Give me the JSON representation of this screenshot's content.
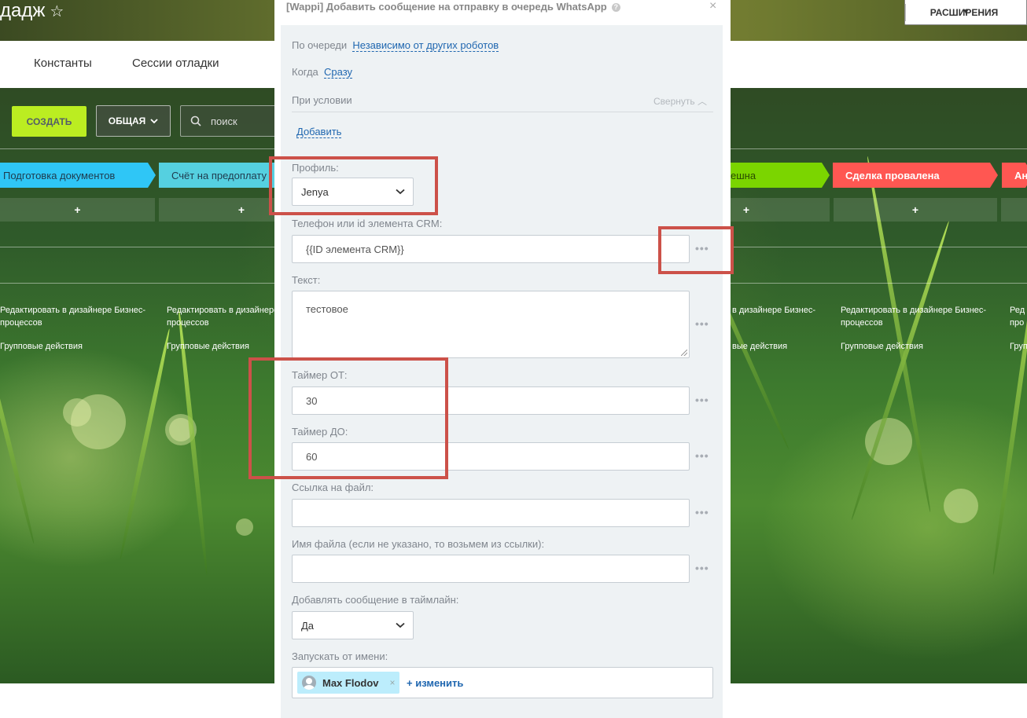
{
  "header": {
    "page_title": "дадж",
    "star_icon": "☆",
    "extensions_label": "РАСШИРЕНИЯ"
  },
  "nav": {
    "constants": "Константы",
    "debug_sessions": "Сессии отладки"
  },
  "toolbar": {
    "create_label": "СОЗДАТЬ",
    "filter_label": "ОБЩАЯ",
    "search_placeholder": "поиск"
  },
  "stages": [
    {
      "label": "Подготовка документов",
      "color": "#2fc6f6"
    },
    {
      "label": "Счёт на предоплату",
      "color": "#55d0e0"
    },
    {
      "label": "ешна",
      "color": "#7bd500"
    },
    {
      "label": "Сделка провалена",
      "color": "#ff5752"
    },
    {
      "label": "Ан",
      "color": "#ff5752"
    }
  ],
  "stage_add": "+",
  "column_links": {
    "edit_designer": "Редактировать в дизайнере Бизнес-процессов",
    "edit_designer_line1": "Редактировать в дизайнере Бизнес-",
    "edit_designer_line2": "процессов",
    "edit_designer_cut1": "в дизайнере Бизнес-",
    "edit_designer_cut2": "Ред",
    "edit_designer_cut3": "про",
    "edit_designer_cut4": "Редактировать в дизайнере",
    "edit_designer_cut5": "процессов",
    "group_actions": "Групповые действия",
    "group_actions_cut1": "вые действия",
    "group_actions_cut2": "Груп"
  },
  "dialog": {
    "title": "[Wappi] Добавить сообщение на отправку в очередь WhatsApp",
    "queue_label": "По очереди",
    "queue_value": "Независимо от других роботов",
    "when_label": "Когда",
    "when_value": "Сразу",
    "condition_label": "При условии",
    "collapse_label": "Свернуть",
    "add_label": "Добавить",
    "profile_label": "Профиль:",
    "profile_value": "Jenya",
    "phone_label": "Телефон или id элемента CRM:",
    "phone_value": "{{ID элемента CRM}}",
    "text_label": "Текст:",
    "text_value": "тестовое",
    "timer_from_label": "Таймер ОТ:",
    "timer_from_value": "30",
    "timer_to_label": "Таймер ДО:",
    "timer_to_value": "60",
    "file_link_label": "Ссылка на файл:",
    "file_link_value": "",
    "file_name_label": "Имя файла (если не указано, то возьмем из ссылки):",
    "file_name_value": "",
    "timeline_label": "Добавлять сообщение в таймлайн:",
    "timeline_value": "Да",
    "run_as_label": "Запускать от имени:",
    "run_as_user": "Max Flodov",
    "change_label": "+ изменить",
    "more_dots": "•••"
  },
  "colors": {
    "accent_link": "#2067b0",
    "create_button": "#bbed21",
    "highlight_frame": "#cc5149"
  }
}
